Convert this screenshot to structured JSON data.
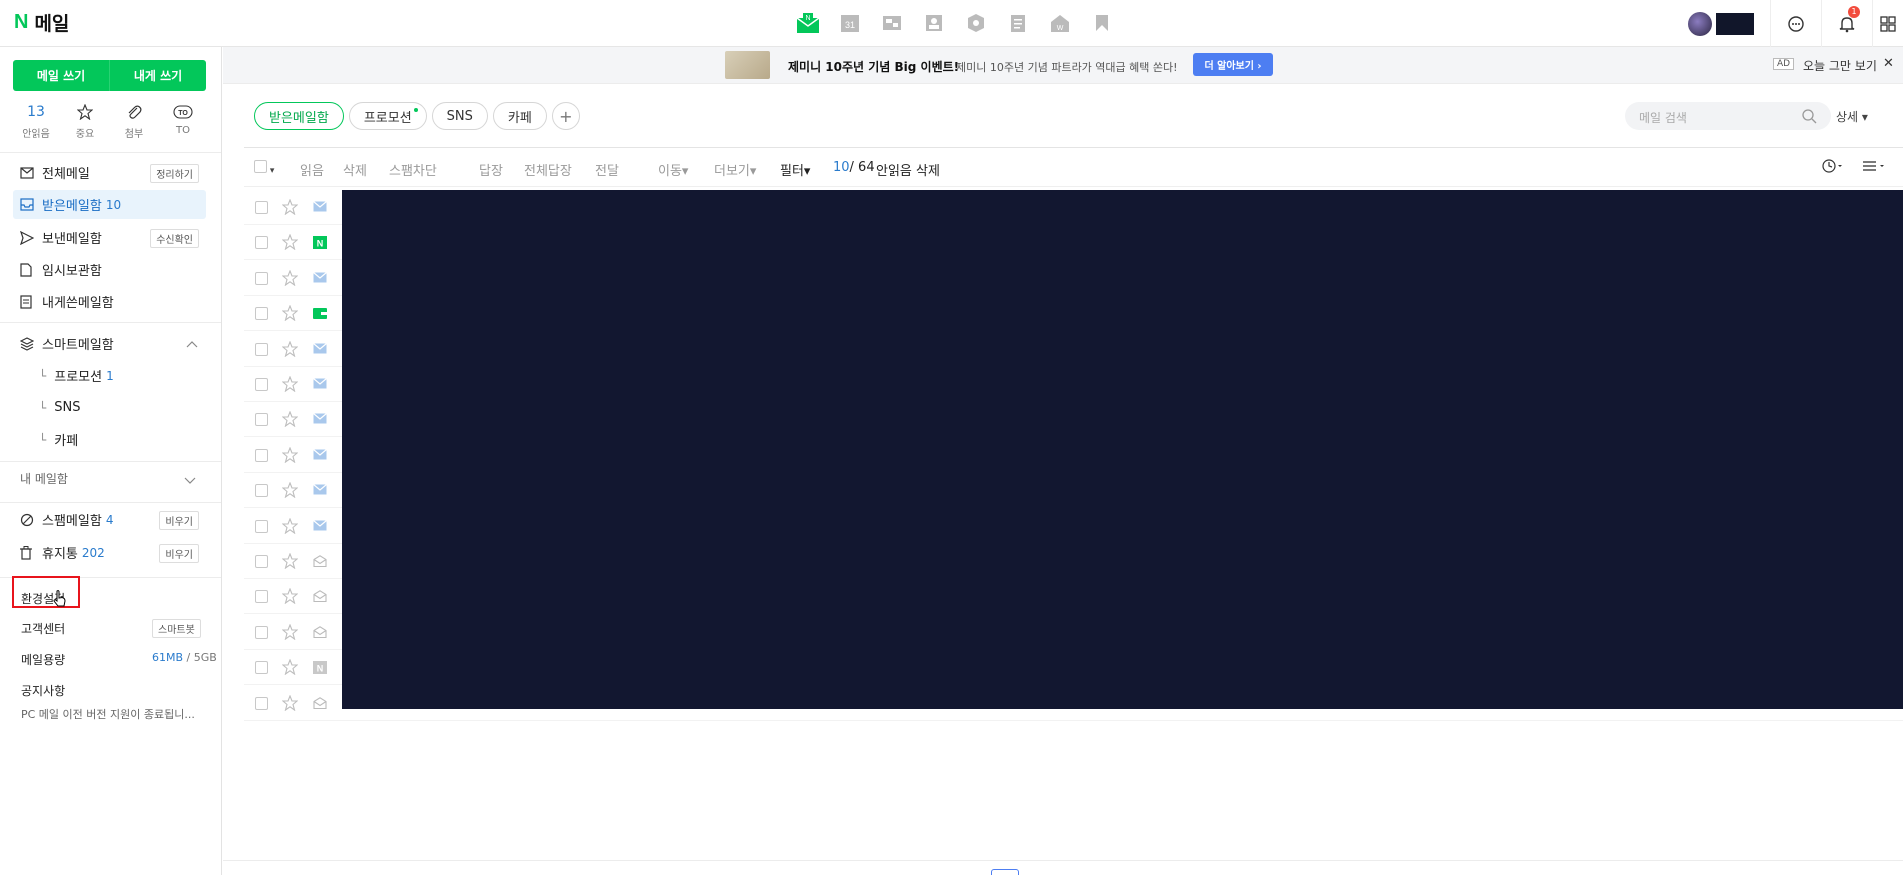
{
  "header": {
    "logo_n": "N",
    "logo_text": "메일",
    "apps": [
      "mail-app-icon",
      "calendar-app-icon",
      "photo-app-icon",
      "contacts-app-icon",
      "box-app-icon",
      "memo-app-icon",
      "office-app-icon",
      "bookmark-app-icon"
    ],
    "notification_count": "1"
  },
  "ad": {
    "badge": "AD",
    "title": "제미니 10주년 기념 Big 이벤트!",
    "description": "제미니 10주년 기념 파트라가 역대급 혜택 쏜다!",
    "cta": "더 알아보기 ›",
    "dismiss": "오늘 그만 보기",
    "close": "✕"
  },
  "sidebar": {
    "write": "메일 쓰기",
    "write_self": "내게 쓰기",
    "quick": [
      {
        "top": "13",
        "label": "안읽음"
      },
      {
        "top": "☆",
        "label": "중요"
      },
      {
        "top": "",
        "label": "첨부"
      },
      {
        "top": "TO",
        "label": "TO"
      }
    ],
    "folders": [
      {
        "label": "전체메일",
        "count": "",
        "action": "정리하기"
      },
      {
        "label": "받은메일함",
        "count": "10",
        "action": ""
      },
      {
        "label": "보낸메일함",
        "count": "",
        "action": "수신확인"
      },
      {
        "label": "임시보관함",
        "count": "",
        "action": ""
      },
      {
        "label": "내게쓴메일함",
        "count": "",
        "action": ""
      }
    ],
    "smart": {
      "label": "스마트메일함",
      "items": [
        {
          "label": "프로모션",
          "count": "1"
        },
        {
          "label": "SNS",
          "count": ""
        },
        {
          "label": "카페",
          "count": ""
        }
      ]
    },
    "my_mail": "내 메일함",
    "spam": {
      "label": "스팸메일함",
      "count": "4",
      "action": "비우기"
    },
    "trash": {
      "label": "휴지통",
      "count": "202",
      "action": "비우기"
    },
    "settings": "환경설정",
    "support": {
      "label": "고객센터",
      "action": "스마트봇"
    },
    "storage": {
      "label": "메일용량",
      "used": "61MB",
      "sep": "/",
      "total": "5GB"
    },
    "notice": {
      "label": "공지사항",
      "text": "PC 메일 이전 버전 지원이 종료됩니..."
    }
  },
  "tabs": [
    {
      "label": "받은메일함",
      "active": true
    },
    {
      "label": "프로모션",
      "dot": true
    },
    {
      "label": "SNS"
    },
    {
      "label": "카페"
    },
    {
      "label": "+"
    }
  ],
  "search": {
    "placeholder": "메일 검색",
    "detail": "상세 ▾"
  },
  "toolbar": {
    "read": "읽음",
    "delete": "삭제",
    "block": "스팸차단",
    "reply": "답장",
    "reply_all": "전체답장",
    "forward": "전달",
    "move": "이동▾",
    "more": "더보기▾",
    "filter": "필터▾",
    "page_cur": "10",
    "page_total": "/ 64",
    "unread_delete": "안읽음 삭제"
  },
  "rows": [
    "mail-icon",
    "naver-icon",
    "mail-icon",
    "wallet-icon",
    "mail-icon",
    "mail-icon",
    "mail-icon",
    "mail-icon",
    "mail-icon",
    "mail-icon",
    "mail-open-icon",
    "mail-open-icon",
    "mail-open-icon",
    "naver-gray-icon",
    "mail-open-icon"
  ]
}
